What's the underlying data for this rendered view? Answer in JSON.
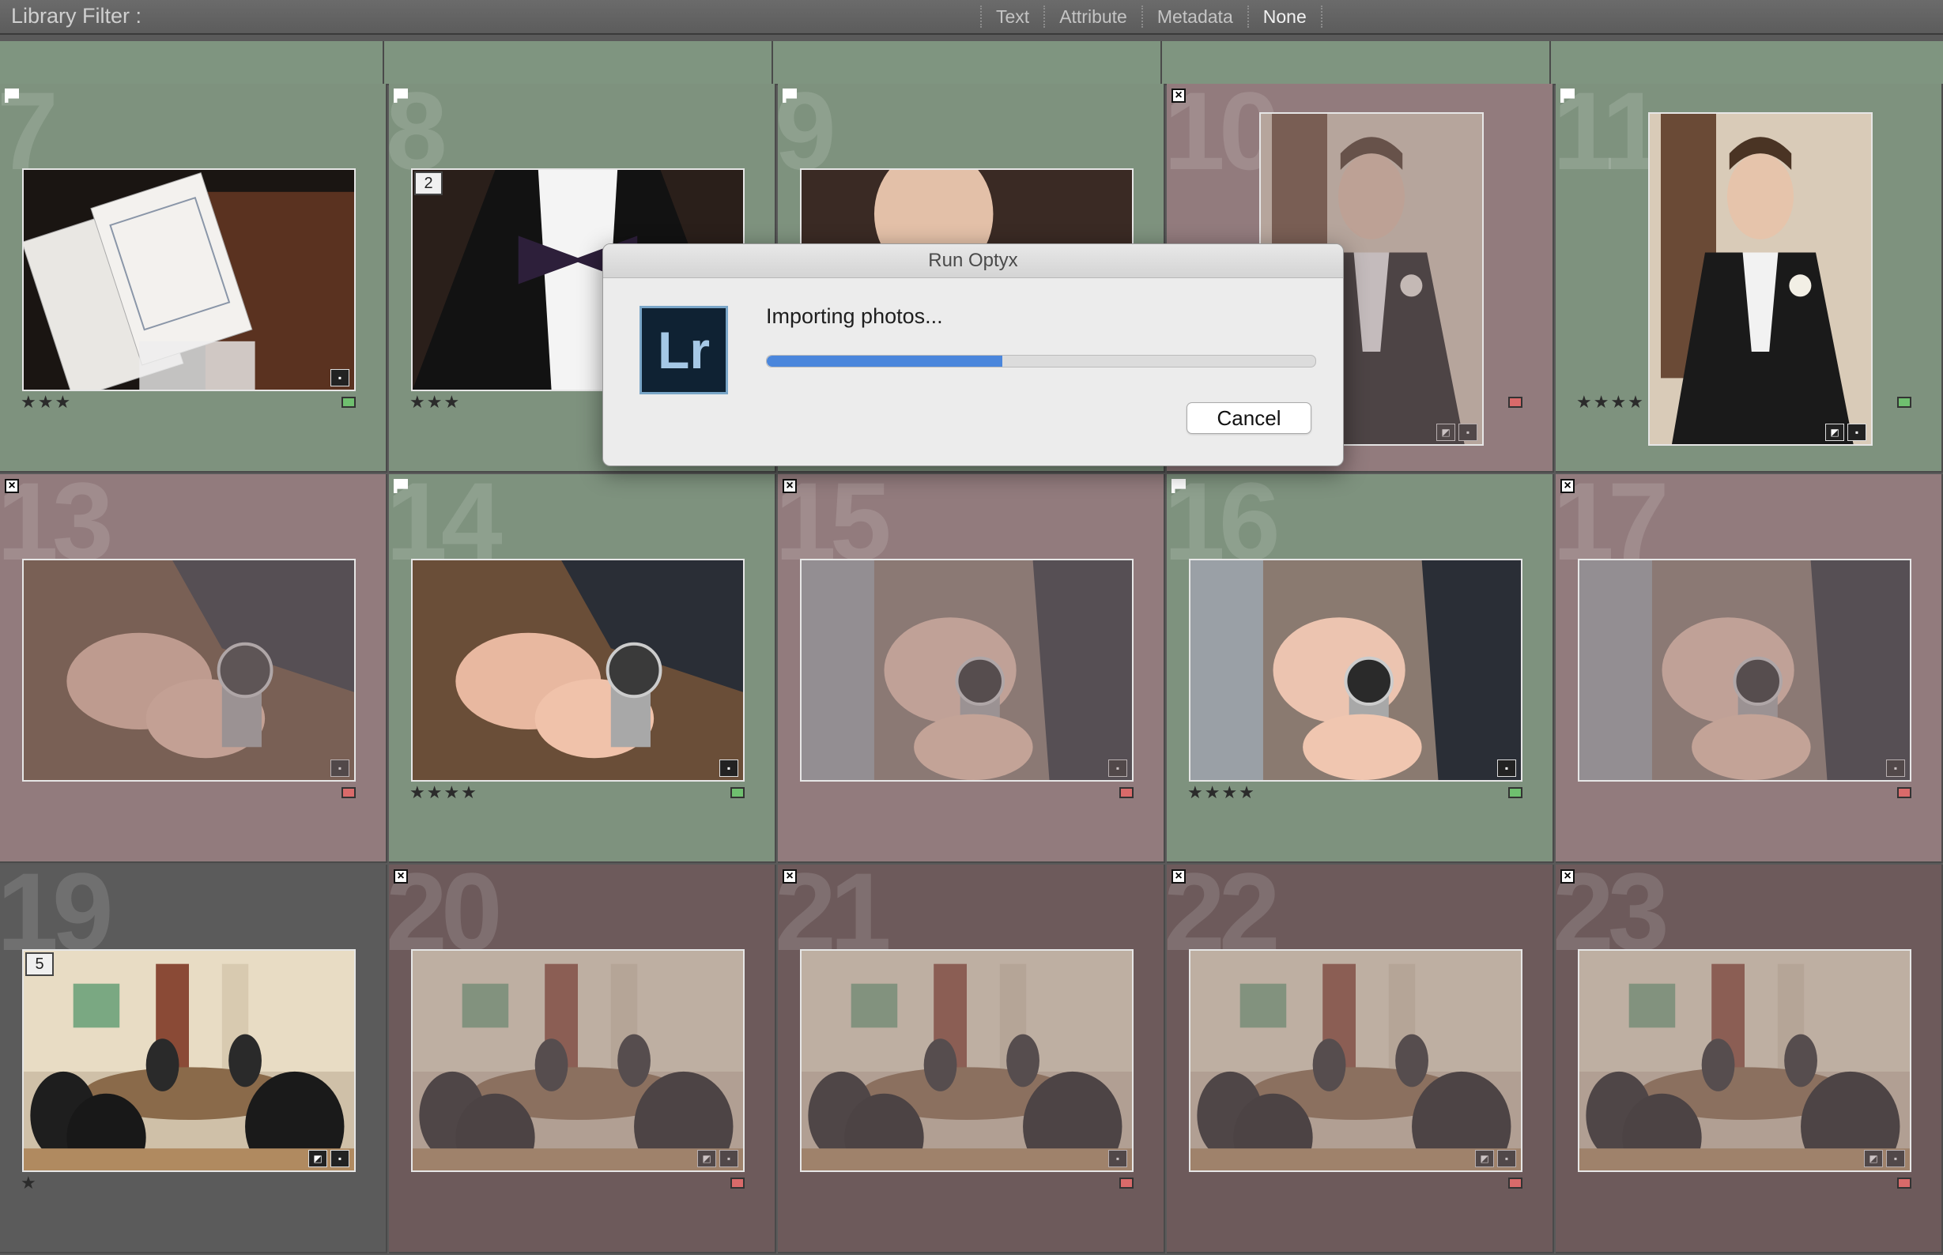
{
  "filter_bar": {
    "title": "Library Filter :",
    "options": [
      {
        "label": "Text",
        "active": false
      },
      {
        "label": "Attribute",
        "active": false
      },
      {
        "label": "Metadata",
        "active": false
      },
      {
        "label": "None",
        "active": true
      }
    ]
  },
  "cells": [
    {
      "index": "7",
      "flag": "pick",
      "label": "green",
      "stars": "★★★",
      "stack": "",
      "bg": "green",
      "orientation": "landscape",
      "faded": false,
      "photo": "menus",
      "icons": [
        "comment-icon"
      ]
    },
    {
      "index": "8",
      "flag": "pick",
      "label": "",
      "stars": "★★★",
      "stack": "2",
      "bg": "green",
      "orientation": "landscape",
      "faded": false,
      "photo": "bowtie",
      "icons": [
        "comment-icon"
      ]
    },
    {
      "index": "9",
      "flag": "pick",
      "label": "",
      "stars": "",
      "stack": "",
      "bg": "green",
      "orientation": "landscape",
      "faded": false,
      "photo": "groom-profile",
      "icons": []
    },
    {
      "index": "10",
      "flag": "reject",
      "label": "red",
      "stars": "",
      "stack": "",
      "bg": "pink",
      "orientation": "portrait",
      "faded": true,
      "photo": "groom-portrait",
      "icons": [
        "edit-icon",
        "comment-icon"
      ]
    },
    {
      "index": "11",
      "flag": "pick",
      "label": "green",
      "stars": "★★★★",
      "stack": "",
      "bg": "green",
      "orientation": "portrait",
      "faded": false,
      "photo": "groom-portrait",
      "icons": [
        "edit-icon",
        "comment-icon"
      ]
    },
    {
      "index": "13",
      "flag": "reject",
      "label": "red",
      "stars": "",
      "stack": "",
      "bg": "pink",
      "orientation": "landscape",
      "faded": true,
      "photo": "watch",
      "icons": [
        "comment-icon"
      ]
    },
    {
      "index": "14",
      "flag": "pick",
      "label": "green",
      "stars": "★★★★",
      "stack": "",
      "bg": "green",
      "orientation": "landscape",
      "faded": false,
      "photo": "watch",
      "icons": [
        "comment-icon"
      ]
    },
    {
      "index": "15",
      "flag": "reject",
      "label": "red",
      "stars": "",
      "stack": "",
      "bg": "pink",
      "orientation": "landscape",
      "faded": true,
      "photo": "watch-window",
      "icons": [
        "comment-icon"
      ]
    },
    {
      "index": "16",
      "flag": "pick",
      "label": "green",
      "stars": "★★★★",
      "stack": "",
      "bg": "green",
      "orientation": "landscape",
      "faded": false,
      "photo": "watch-window",
      "icons": [
        "comment-icon"
      ]
    },
    {
      "index": "17",
      "flag": "reject",
      "label": "red",
      "stars": "",
      "stack": "",
      "bg": "pink",
      "orientation": "landscape",
      "faded": true,
      "photo": "watch-window",
      "icons": [
        "comment-icon"
      ]
    },
    {
      "index": "19",
      "flag": "",
      "label": "",
      "stars": "★",
      "stack": "5",
      "bg": "grey",
      "orientation": "landscape",
      "faded": false,
      "photo": "meeting",
      "icons": [
        "edit-icon",
        "comment-icon"
      ]
    },
    {
      "index": "20",
      "flag": "reject",
      "label": "red",
      "stars": "",
      "stack": "",
      "bg": "dark",
      "orientation": "landscape",
      "faded": true,
      "photo": "meeting",
      "icons": [
        "edit-icon",
        "comment-icon"
      ]
    },
    {
      "index": "21",
      "flag": "reject",
      "label": "red",
      "stars": "",
      "stack": "",
      "bg": "dark",
      "orientation": "landscape",
      "faded": true,
      "photo": "meeting",
      "icons": [
        "comment-icon"
      ]
    },
    {
      "index": "22",
      "flag": "reject",
      "label": "red",
      "stars": "",
      "stack": "",
      "bg": "dark",
      "orientation": "landscape",
      "faded": true,
      "photo": "meeting",
      "icons": [
        "edit-icon",
        "comment-icon"
      ]
    },
    {
      "index": "23",
      "flag": "reject",
      "label": "red",
      "stars": "",
      "stack": "",
      "bg": "dark",
      "orientation": "landscape",
      "faded": true,
      "photo": "meeting",
      "icons": [
        "edit-icon",
        "comment-icon"
      ]
    }
  ],
  "dialog": {
    "title": "Run Optyx",
    "logo_text": "Lr",
    "message": "Importing photos...",
    "progress": 0.43,
    "cancel_label": "Cancel"
  },
  "colors": {
    "pick_bg": "#7e927e",
    "reject_bg": "#927b7d",
    "progress": "#4a86dc"
  }
}
